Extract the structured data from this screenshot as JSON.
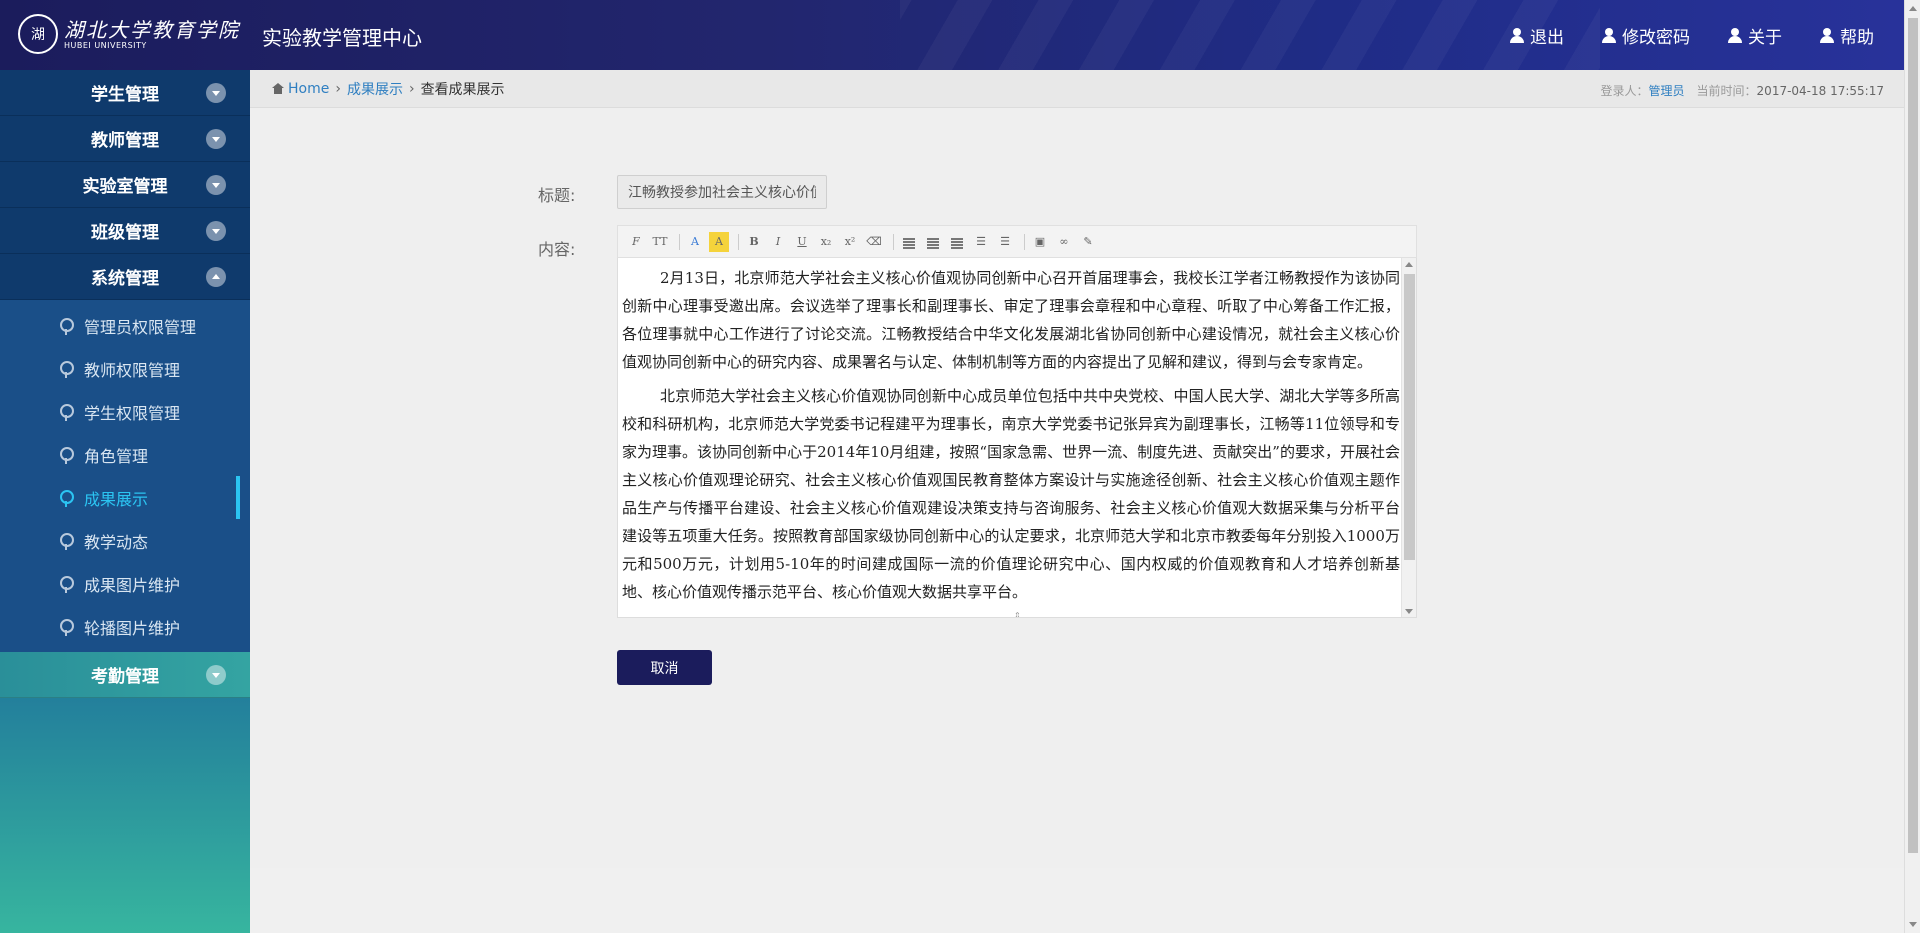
{
  "header": {
    "logo_cn": "湖北大学教育学院",
    "logo_en": "HUBEI UNIVERSITY",
    "app_title": "实验教学管理中心",
    "nav": {
      "logout": "退出",
      "change_password": "修改密码",
      "about": "关于",
      "help": "帮助"
    }
  },
  "sidebar": {
    "student_mgmt": "学生管理",
    "teacher_mgmt": "教师管理",
    "lab_mgmt": "实验室管理",
    "class_mgmt": "班级管理",
    "system_mgmt": "系统管理",
    "sub": {
      "admin_perm": "管理员权限管理",
      "teacher_perm": "教师权限管理",
      "student_perm": "学生权限管理",
      "role_mgmt": "角色管理",
      "achievements": "成果展示",
      "teaching_news": "教学动态",
      "achievement_images": "成果图片维护",
      "carousel_images": "轮播图片维护"
    },
    "attendance_mgmt": "考勤管理"
  },
  "breadcrumb": {
    "home": "Home",
    "parent": "成果展示",
    "current": "查看成果展示",
    "login_label": "登录人：",
    "login_user": "管理员",
    "time_label": "当前时间：",
    "time_value": "2017-04-18 17:55:17"
  },
  "form": {
    "title_label": "标题:",
    "title_value": "江畅教授参加社会主义核心价值观协同创新中心首届理事会",
    "content_label": "内容:",
    "paragraph_1": "2月13日，北京师范大学社会主义核心价值观协同创新中心召开首届理事会，我校长江学者江畅教授作为该协同创新中心理事受邀出席。会议选举了理事长和副理事长、审定了理事会章程和中心章程、听取了中心筹备工作汇报，各位理事就中心工作进行了讨论交流。江畅教授结合中华文化发展湖北省协同创新中心建设情况，就社会主义核心价值观协同创新中心的研究内容、成果署名与认定、体制机制等方面的内容提出了见解和建议，得到与会专家肯定。",
    "paragraph_2": "北京师范大学社会主义核心价值观协同创新中心成员单位包括中共中央党校、中国人民大学、湖北大学等多所高校和科研机构，北京师范大学党委书记程建平为理事长，南京大学党委书记张异宾为副理事长，江畅等11位领导和专家为理事。该协同创新中心于2014年10月组建，按照“国家急需、世界一流、制度先进、贡献突出”的要求，开展社会主义核心价值观理论研究、社会主义核心价值观国民教育整体方案设计与实施途径创新、社会主义核心价值观主题作品生产与传播平台建设、社会主义核心价值观建设决策支持与咨询服务、社会主义核心价值观大数据采集与分析平台建设等五项重大任务。按照教育部国家级协同创新中心的认定要求，北京师范大学和北京市教委每年分别投入1000万元和500万元，计划用5-10年的时间建成国际一流的价值理论研究中心、国内权威的价值观教育和人才培养创新基地、核心价值观传播示范平台、核心价值观大数据共享平台。",
    "cancel_label": "取消"
  },
  "toolbar": {
    "font_family": "F",
    "font_size": "TT",
    "font_color": "A",
    "bg_color": "A",
    "bold": "B",
    "italic": "I",
    "underline": "U",
    "subscript": "x₂",
    "superscript": "x²"
  }
}
